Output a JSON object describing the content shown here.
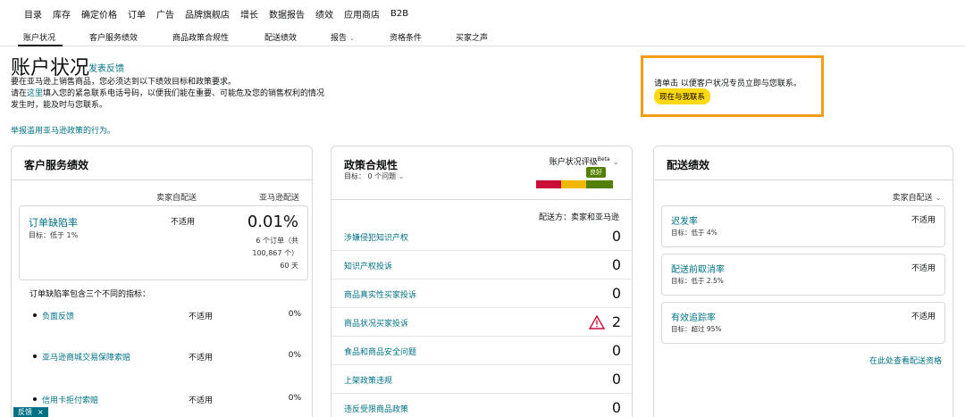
{
  "topnav": [
    "目录",
    "库存",
    "确定价格",
    "订单",
    "广告",
    "品牌旗舰店",
    "增长",
    "数据报告",
    "绩效",
    "应用商店",
    "B2B"
  ],
  "subnav": [
    {
      "label": "账户状况"
    },
    {
      "label": "客户服务绩效"
    },
    {
      "label": "商品政策合规性"
    },
    {
      "label": "配送绩效"
    },
    {
      "label": "报告"
    },
    {
      "label": "资格条件"
    },
    {
      "label": "买家之声"
    }
  ],
  "header": {
    "title": "账户状况",
    "feedback": "发表反馈",
    "intro_line1": "要在亚马逊上销售商品，您必须达到以下绩效目标和政策要求。",
    "intro_line2a": "请在",
    "intro_link": "这里",
    "intro_line2b": "填入您的紧急联系电话号码，以便我们能在重要、可能危及您的销售权利的情况发生时，能及时与您联系。",
    "report_link": "举报滥用亚马逊政策的行为。"
  },
  "contact": {
    "text": "请单击 以便客户状况专员立即与您联系。",
    "button": "现在与我联系"
  },
  "cs_card": {
    "title": "客户服务绩效",
    "col1": "卖家自配送",
    "col2": "亚马逊配送",
    "metric_name": "订单缺陷率",
    "metric_target": "目标：低于 1%",
    "metric_na": "不适用",
    "metric_value": "0.01%",
    "metric_sub1": "6 个订单（共",
    "metric_sub2": "100,867 个）",
    "metric_sub3": "60 天",
    "intro": "订单缺陷率包含三个不同的指标：",
    "rows": [
      {
        "label": "负面反馈",
        "na": "不适用",
        "pct": "0%"
      },
      {
        "label": "亚马逊商城交易保障索赔",
        "na": "不适用",
        "pct": "0%"
      },
      {
        "label": "信用卡拒付索赔",
        "na": "不适用",
        "pct": "0%"
      }
    ]
  },
  "policy_card": {
    "title": "政策合规性",
    "target": "目标： 0 个问题",
    "rating_label": "账户状况评级",
    "beta": "Beta",
    "good": "良好",
    "ship_from": "配送方：卖家和亚马逊",
    "rows": [
      {
        "label": "涉嫌侵犯知识产权",
        "value": "0"
      },
      {
        "label": "知识产权投诉",
        "value": "0"
      },
      {
        "label": "商品真实性买家投诉",
        "value": "0"
      },
      {
        "label": "商品状况买家投诉",
        "value": "2"
      },
      {
        "label": "食品和商品安全问题",
        "value": "0"
      },
      {
        "label": "上架政策违规",
        "value": "0"
      },
      {
        "label": "违反受限商品政策",
        "value": "0"
      }
    ],
    "gauge_colors": [
      "#cc0c39",
      "#f0b800",
      "#538000"
    ]
  },
  "shipping_card": {
    "title": "配送绩效",
    "dropdown": "卖家自配送",
    "boxes": [
      {
        "name": "迟发率",
        "target": "目标：低于 4%",
        "na": "不适用"
      },
      {
        "name": "配送前取消率",
        "target": "目标：低于 2.5%",
        "na": "不适用"
      },
      {
        "name": "有效追踪率",
        "target": "目标：超过 95%",
        "na": "不适用"
      }
    ],
    "link": "在此处查看配送资格"
  },
  "feedback_tab": {
    "label": "反馈",
    "close": "×"
  }
}
